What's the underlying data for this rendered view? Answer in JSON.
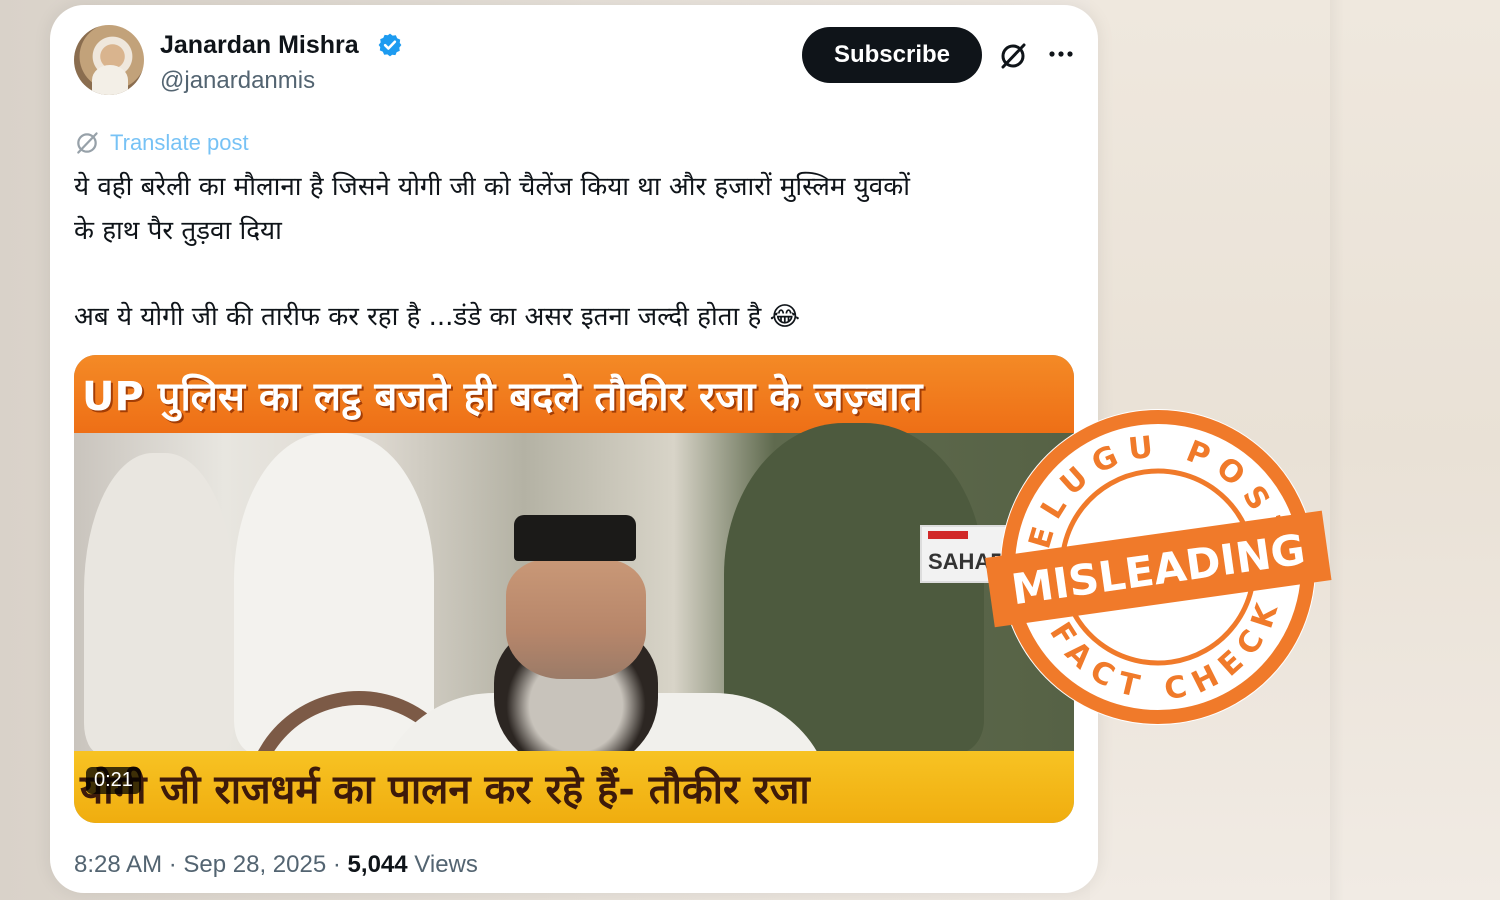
{
  "author": {
    "name": "Janardan Mishra",
    "handle": "@janardanmis"
  },
  "header": {
    "subscribe_label": "Subscribe",
    "grok_icon": "grok-icon",
    "more_icon": "more-icon"
  },
  "translate_label": "Translate post",
  "post": {
    "line1": "ये वही बरेली का मौलाना है जिसने योगी जी को चैलेंज किया था और हजारों मुस्लिम युवकों",
    "line2": "के हाथ पैर तुड़वा दिया",
    "line3": "अब ये योगी जी की तारीफ कर रहा है ...डंडे का असर इतना जल्दी होता है 😂"
  },
  "media": {
    "top_banner": "UP पुलिस का लट्ठ बजते ही बदले तौकीर रजा के जज़्बात",
    "bottom_banner": "योगी जी राजधर्म का पालन कर रहे हैं- तौकीर रजा",
    "duration": "0:21",
    "channel_logo": "SAHARA"
  },
  "meta": {
    "time": "8:28 AM",
    "date": "Sep 28, 2025",
    "views_count": "5,044",
    "views_label": "Views"
  },
  "stamp": {
    "top_text": "TELUGU POST",
    "verdict": "MISLEADING",
    "bottom_text": "FACT CHECK",
    "color": "#f07a2a"
  },
  "colors": {
    "accent_link": "#1d9bf0",
    "verified": "#1d9bf0",
    "text_primary": "#0f1419",
    "text_secondary": "#536471"
  }
}
